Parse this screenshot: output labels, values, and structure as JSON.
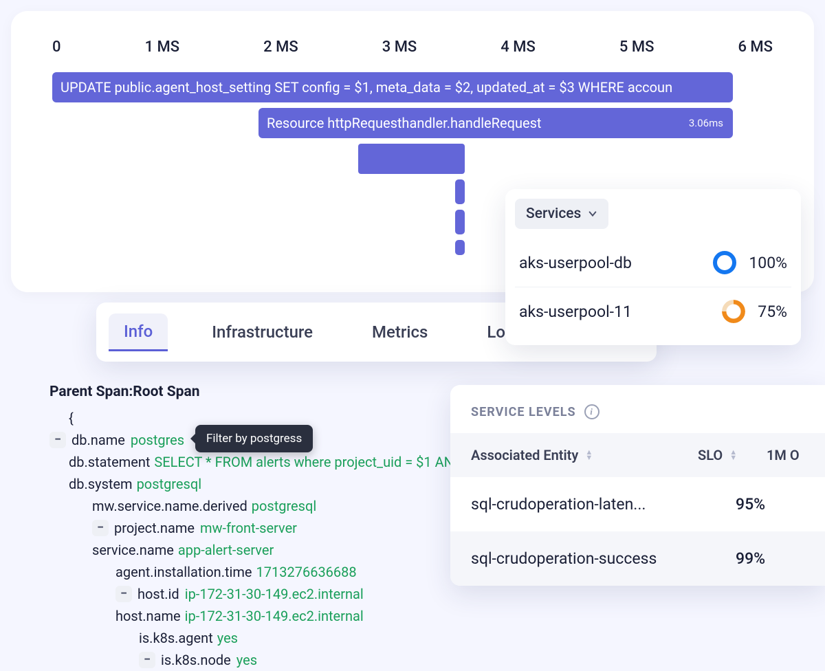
{
  "timeline": {
    "ticks": [
      "0",
      "1 MS",
      "2 MS",
      "3 MS",
      "4 MS",
      "5 MS",
      "6 MS"
    ]
  },
  "spans": {
    "main": "UPDATE public.agent_host_setting SET config = $1, meta_data = $2, updated_at = $3 WHERE accoun",
    "sub": "Resource httpRequesthandler.handleRequest",
    "sub_duration": "3.06ms"
  },
  "tabs": {
    "info": "Info",
    "infrastructure": "Infrastructure",
    "metrics": "Metrics",
    "logs": "Logs"
  },
  "services": {
    "dropdown": "Services",
    "items": [
      {
        "name": "aks-userpool-db",
        "pct": "100%"
      },
      {
        "name": "aks-userpool-11",
        "pct": "75%"
      }
    ]
  },
  "parent_span": {
    "label": "Parent Span:",
    "value": "Root Span",
    "open_brace": "{",
    "lines": {
      "db_name_k": "db.name",
      "db_name_v": "postgres",
      "db_statement_k": "db.statement",
      "db_statement_v": "SELECT * FROM alerts where project_uid = $1 AN",
      "db_system_k": "db.system",
      "db_system_v": "postgresql",
      "mw_svc_k": "mw.service.name.derived",
      "mw_svc_v": "postgresql",
      "project_k": "project.name",
      "project_v": "mw-front-server",
      "service_k": "service.name",
      "service_v": "app-alert-server",
      "agent_k": "agent.installation.time",
      "agent_v": "1713276636688",
      "hostid_k": "host.id",
      "hostid_v": "ip-172-31-30-149.ec2.internal",
      "hostname_k": "host.name",
      "hostname_v": "ip-172-31-30-149.ec2.internal",
      "isk8sagent_k": "is.k8s.agent",
      "isk8sagent_v": "yes",
      "isk8snode_k": "is.k8s.node",
      "isk8snode_v": "yes"
    }
  },
  "tooltip": "Filter by postgress",
  "service_levels": {
    "title": "SERVICE LEVELS",
    "cols": {
      "entity": "Associated Entity",
      "slo": "SLO",
      "onem": "1M O"
    },
    "rows": [
      {
        "name": "sql-crudoperation-laten...",
        "slo": "95%"
      },
      {
        "name": "sql-crudoperation-success",
        "slo": "99%"
      }
    ]
  }
}
